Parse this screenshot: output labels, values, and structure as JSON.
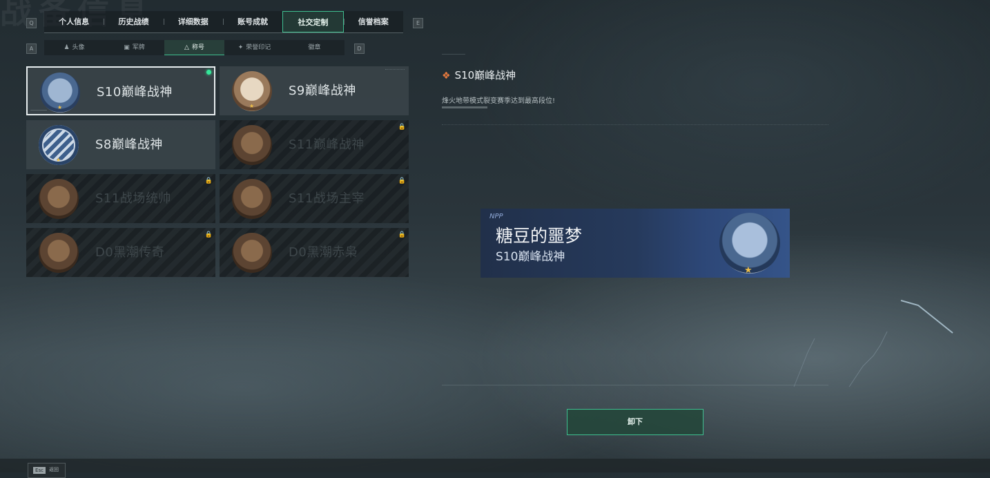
{
  "background_title": "战备信息",
  "nav": {
    "prev_key": "Q",
    "next_key": "E",
    "tabs": [
      {
        "label": "个人信息"
      },
      {
        "label": "历史战绩"
      },
      {
        "label": "详细数据"
      },
      {
        "label": "账号成就"
      },
      {
        "label": "社交定制",
        "active": true
      },
      {
        "label": "信誉档案"
      }
    ]
  },
  "subnav": {
    "prev_key": "A",
    "next_key": "D",
    "tabs": [
      {
        "label": "头像",
        "icon": "person-icon"
      },
      {
        "label": "军牌",
        "icon": "dogtag-icon"
      },
      {
        "label": "称号",
        "icon": "triangle-icon",
        "active": true
      },
      {
        "label": "荣誉印记",
        "icon": "emblem-icon"
      },
      {
        "label": "徽章",
        "icon": ""
      }
    ]
  },
  "titles": [
    {
      "name": "S10巅峰战神",
      "selected": true,
      "equipped": true,
      "locked": false
    },
    {
      "name": "S9巅峰战神",
      "selected": false,
      "equipped": false,
      "locked": false
    },
    {
      "name": "S8巅峰战神",
      "selected": false,
      "equipped": false,
      "locked": false
    },
    {
      "name": "S11巅峰战神",
      "selected": false,
      "equipped": false,
      "locked": true
    },
    {
      "name": "S11战场统帅",
      "selected": false,
      "equipped": false,
      "locked": true
    },
    {
      "name": "S11战场主宰",
      "selected": false,
      "equipped": false,
      "locked": true
    },
    {
      "name": "D0黑潮传奇",
      "selected": false,
      "equipped": false,
      "locked": true
    },
    {
      "name": "D0黑潮赤枭",
      "selected": false,
      "equipped": false,
      "locked": true
    }
  ],
  "detail": {
    "title": "S10巅峰战神",
    "description": "烽火地带模式裂变赛季达到最高段位!"
  },
  "nameplate": {
    "player_name": "糖豆的噩梦",
    "title": "S10巅峰战神"
  },
  "action_button": {
    "label": "卸下"
  },
  "footer": {
    "key": "Esc",
    "label": "返回"
  },
  "colors": {
    "accent": "#3fbf90",
    "equipped_dot": "#35e79a",
    "star": "#f0c048",
    "detail_icon": "#e77a3e"
  }
}
